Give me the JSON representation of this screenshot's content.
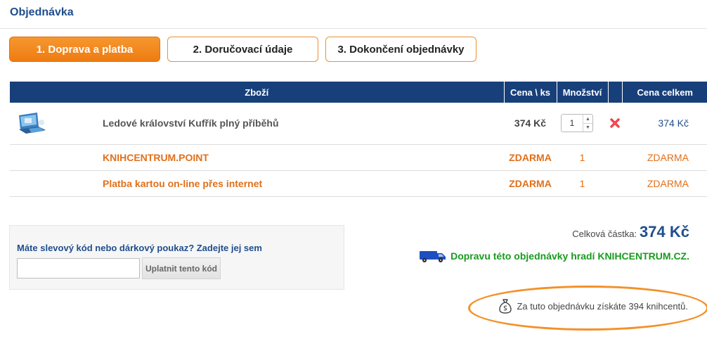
{
  "page": {
    "title": "Objednávka"
  },
  "steps": [
    {
      "label": "1. Doprava a platba",
      "active": true
    },
    {
      "label": "2. Doručovací údaje",
      "active": false
    },
    {
      "label": "3. Dokončení objednávky",
      "active": false
    }
  ],
  "cart": {
    "headers": {
      "item": "Zboží",
      "unit_price": "Cena \\ ks",
      "quantity": "Množství",
      "total": "Cena celkem"
    },
    "product": {
      "name": "Ledové království Kufřík plný příběhů",
      "unit_price": "374 Kč",
      "quantity": "1",
      "total": "374 Kč",
      "icon": "product-thumbnail"
    },
    "extras": [
      {
        "name": "KNIHCENTRUM.POINT",
        "unit_price": "ZDARMA",
        "quantity": "1",
        "total": "ZDARMA"
      },
      {
        "name": "Platba kartou on-line přes internet",
        "unit_price": "ZDARMA",
        "quantity": "1",
        "total": "ZDARMA"
      }
    ]
  },
  "coupon": {
    "label": "Máte slevový kód nebo dárkový poukaz? Zadejte jej sem",
    "value": "",
    "placeholder": "",
    "button_label": "Uplatnit tento kód"
  },
  "summary": {
    "total_label": "Celková částka:",
    "total_value": "374 Kč",
    "delivery_text": "Dopravu této objednávky hradí KNIHCENTRUM.CZ.",
    "points_text": "Za tuto objednávku získáte 394 knihcentů."
  },
  "colors": {
    "accent_orange": "#ee7c12",
    "header_blue": "#173f7a",
    "link_blue": "#1f4e8c",
    "green": "#199b1e",
    "remove_red": "#e8222b"
  },
  "icons": {
    "delete": "red-x-icon",
    "delivery": "delivery-van-icon",
    "points": "money-bag-icon"
  }
}
